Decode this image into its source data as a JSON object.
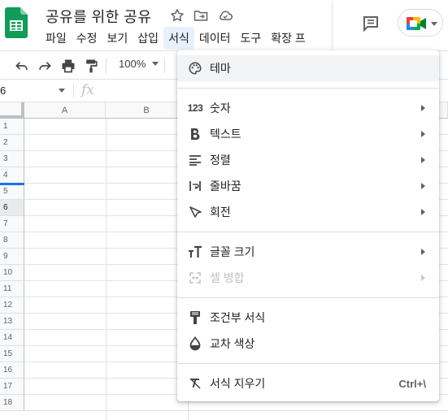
{
  "header": {
    "doc_title": "공유를 위한 공유",
    "menu": [
      "파일",
      "수정",
      "보기",
      "삽입",
      "서식",
      "데이터",
      "도구",
      "확장 프"
    ],
    "active_menu_index": 4
  },
  "toolbar": {
    "zoom": "100%"
  },
  "formula_bar": {
    "cell_ref": "6",
    "fx": "fx"
  },
  "grid": {
    "columns": [
      "A",
      "B"
    ],
    "rows": [
      "1",
      "2",
      "3",
      "4",
      "5",
      "6",
      "7",
      "8",
      "9",
      "10",
      "11",
      "12",
      "13",
      "14",
      "15",
      "16",
      "17",
      "18"
    ],
    "selected_row": "6"
  },
  "format_menu": {
    "theme": "테마",
    "number": "숫자",
    "number_icon": "123",
    "text": "텍스트",
    "align": "정렬",
    "wrap": "줄바꿈",
    "rotate": "회전",
    "font_size": "글꼴 크기",
    "merge": "셀 병합",
    "conditional": "조건부 서식",
    "alternating": "교차 색상",
    "clear": "서식 지우기",
    "clear_shortcut": "Ctrl+\\"
  },
  "colors": {
    "accent_blue": "#1a73e8",
    "sheets_green": "#0f9d58",
    "menu_active_bg": "#e8f0fe"
  },
  "icons": [
    "sheets-logo-icon",
    "star-icon",
    "move-to-folder-icon",
    "cloud-saved-icon",
    "comment-icon",
    "meet-icon",
    "undo-icon",
    "redo-icon",
    "print-icon",
    "paint-format-icon",
    "palette-icon",
    "bold-icon",
    "align-icon",
    "wrap-icon",
    "rotate-icon",
    "font-size-icon",
    "merge-icon",
    "conditional-format-icon",
    "alternating-colors-icon",
    "clear-format-icon"
  ]
}
